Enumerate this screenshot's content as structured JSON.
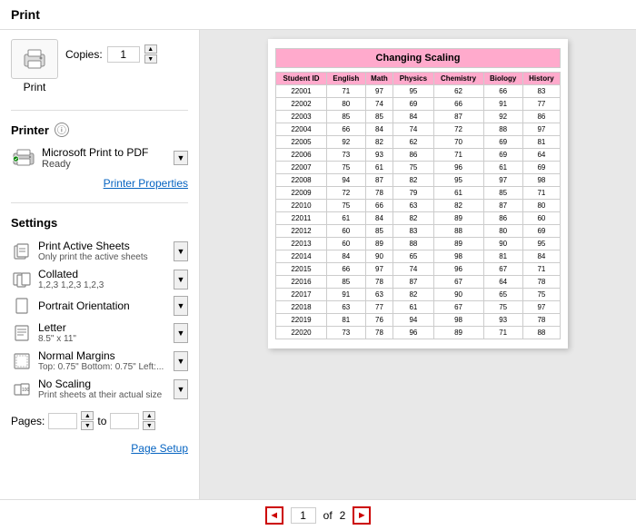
{
  "title": "Print",
  "print_button_label": "Print",
  "copies": {
    "label": "Copies:",
    "value": "1"
  },
  "printer_section": {
    "title": "Printer",
    "name": "Microsoft Print to PDF",
    "status": "Ready",
    "properties_link": "Printer Properties"
  },
  "settings_section": {
    "title": "Settings"
  },
  "settings": [
    {
      "main": "Print Active Sheets",
      "sub": "Only print the active sheets",
      "icon": "sheets-icon"
    },
    {
      "main": "Collated",
      "sub": "1,2,3  1,2,3  1,2,3",
      "icon": "collate-icon"
    },
    {
      "main": "Portrait Orientation",
      "sub": "",
      "icon": "portrait-icon"
    },
    {
      "main": "Letter",
      "sub": "8.5\" x 11\"",
      "icon": "letter-icon"
    },
    {
      "main": "Normal Margins",
      "sub": "Top: 0.75\" Bottom: 0.75\" Left:...",
      "icon": "margins-icon"
    },
    {
      "main": "No Scaling",
      "sub": "Print sheets at their actual size",
      "icon": "scaling-icon"
    }
  ],
  "pages": {
    "label": "Pages:",
    "from": "",
    "to_label": "to",
    "to": ""
  },
  "page_setup_link": "Page Setup",
  "preview": {
    "title": "Changing Scaling",
    "headers": [
      "Student ID",
      "English",
      "Math",
      "Physics",
      "Chemistry",
      "Biology",
      "History"
    ],
    "rows": [
      [
        "22001",
        "71",
        "97",
        "95",
        "62",
        "66",
        "83"
      ],
      [
        "22002",
        "80",
        "74",
        "69",
        "66",
        "91",
        "77"
      ],
      [
        "22003",
        "85",
        "85",
        "84",
        "87",
        "92",
        "86"
      ],
      [
        "22004",
        "66",
        "84",
        "74",
        "72",
        "88",
        "97"
      ],
      [
        "22005",
        "92",
        "82",
        "62",
        "70",
        "69",
        "81"
      ],
      [
        "22006",
        "73",
        "93",
        "86",
        "71",
        "69",
        "64"
      ],
      [
        "22007",
        "75",
        "61",
        "75",
        "96",
        "61",
        "69"
      ],
      [
        "22008",
        "94",
        "87",
        "82",
        "95",
        "97",
        "98"
      ],
      [
        "22009",
        "72",
        "78",
        "79",
        "61",
        "85",
        "71"
      ],
      [
        "22010",
        "75",
        "66",
        "63",
        "82",
        "87",
        "80"
      ],
      [
        "22011",
        "61",
        "84",
        "82",
        "89",
        "86",
        "60"
      ],
      [
        "22012",
        "60",
        "85",
        "83",
        "88",
        "80",
        "69"
      ],
      [
        "22013",
        "60",
        "89",
        "88",
        "89",
        "90",
        "95"
      ],
      [
        "22014",
        "84",
        "90",
        "65",
        "98",
        "81",
        "84"
      ],
      [
        "22015",
        "66",
        "97",
        "74",
        "96",
        "67",
        "71"
      ],
      [
        "22016",
        "85",
        "78",
        "87",
        "67",
        "64",
        "78"
      ],
      [
        "22017",
        "91",
        "63",
        "82",
        "90",
        "65",
        "75"
      ],
      [
        "22018",
        "63",
        "77",
        "61",
        "67",
        "75",
        "97"
      ],
      [
        "22019",
        "81",
        "76",
        "94",
        "98",
        "93",
        "78"
      ],
      [
        "22020",
        "73",
        "78",
        "96",
        "89",
        "71",
        "88"
      ]
    ]
  },
  "pagination": {
    "current": "1",
    "total": "2",
    "prev_label": "◄",
    "next_label": "►",
    "of_label": "of"
  }
}
